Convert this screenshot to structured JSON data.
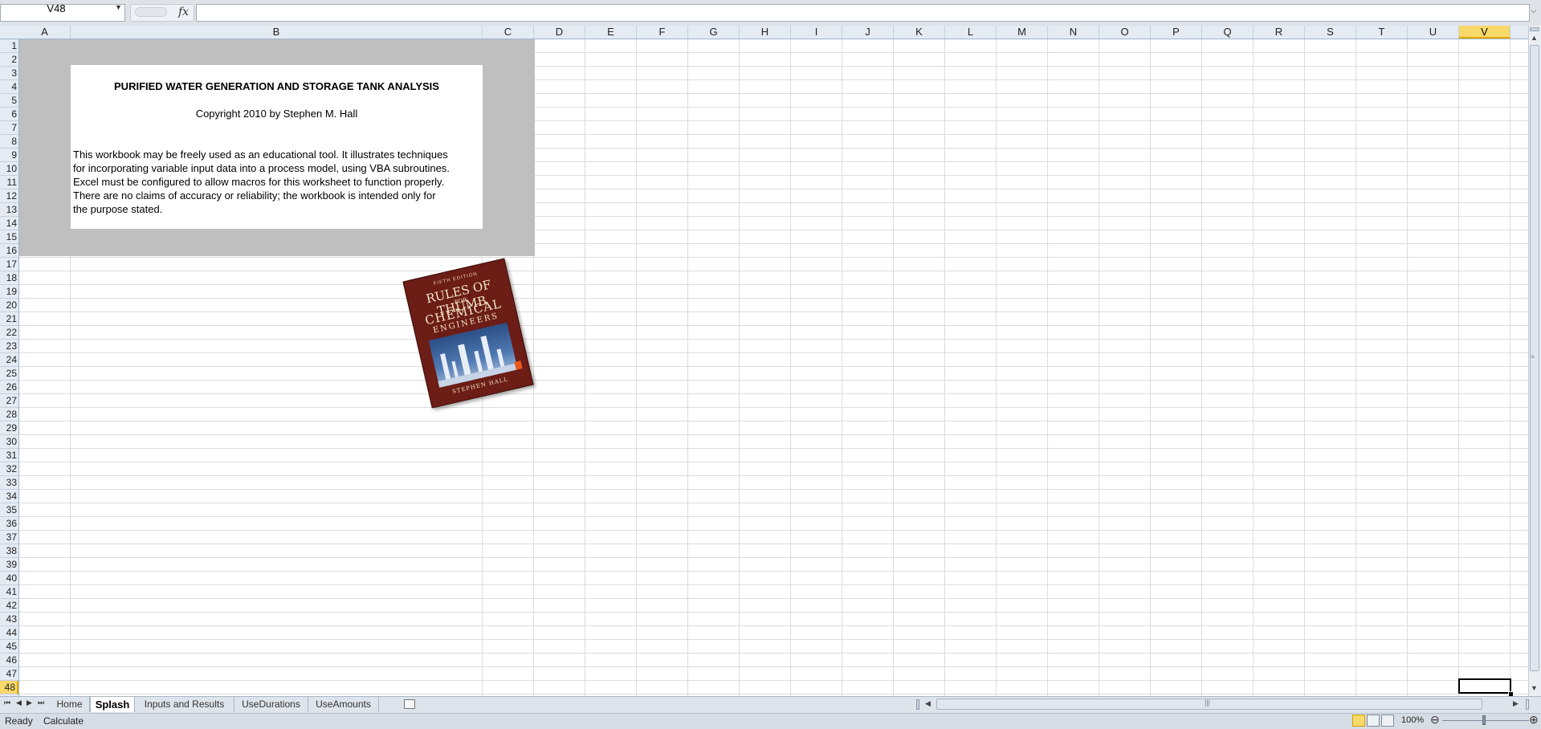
{
  "formula_bar": {
    "name_box": "V48",
    "fx_label": "fx",
    "formula": ""
  },
  "columns": [
    {
      "label": "A",
      "w": 64
    },
    {
      "label": "B",
      "w": 513
    },
    {
      "label": "C",
      "w": 64
    },
    {
      "label": "D",
      "w": 64
    },
    {
      "label": "E",
      "w": 64
    },
    {
      "label": "F",
      "w": 64
    },
    {
      "label": "G",
      "w": 64
    },
    {
      "label": "H",
      "w": 64
    },
    {
      "label": "I",
      "w": 64
    },
    {
      "label": "J",
      "w": 64
    },
    {
      "label": "K",
      "w": 64
    },
    {
      "label": "L",
      "w": 64
    },
    {
      "label": "M",
      "w": 64
    },
    {
      "label": "N",
      "w": 64
    },
    {
      "label": "O",
      "w": 64
    },
    {
      "label": "P",
      "w": 64
    },
    {
      "label": "Q",
      "w": 64
    },
    {
      "label": "R",
      "w": 64
    },
    {
      "label": "S",
      "w": 64
    },
    {
      "label": "T",
      "w": 64
    },
    {
      "label": "U",
      "w": 64
    },
    {
      "label": "V",
      "w": 64
    }
  ],
  "selected_column": "V",
  "selected_row": 48,
  "row_count": 48,
  "splash": {
    "title": "PURIFIED WATER GENERATION AND STORAGE TANK ANALYSIS",
    "copyright": "Copyright 2010 by Stephen M. Hall",
    "lines": [
      "This workbook may be freely used as an educational tool. It illustrates techniques",
      "for incorporating variable input data into a process model, using VBA subroutines.",
      "Excel must be configured to allow macros for this worksheet to function properly.",
      "There are no claims of accuracy or reliability; the workbook is intended only for",
      "the purpose stated."
    ]
  },
  "book": {
    "edition": "FIFTH EDITION",
    "title_line1": "RULES OF THUMB",
    "title_line2": "FOR",
    "title_line3": "CHEMICAL",
    "title_line4": "ENGINEERS",
    "author": "STEPHEN HALL"
  },
  "sheet_tabs": [
    {
      "label": "Home",
      "active": false
    },
    {
      "label": "Splash",
      "active": true
    },
    {
      "label": "Inputs and Results",
      "active": false
    },
    {
      "label": "UseDurations",
      "active": false
    },
    {
      "label": "UseAmounts",
      "active": false
    }
  ],
  "status": {
    "ready": "Ready",
    "calculate": "Calculate",
    "zoom": "100%"
  },
  "colors": {
    "header_bg": "#e4ebf3",
    "selected_header": "#f9d96a",
    "banner_gray": "#bfbfbf",
    "book_cover": "#6b1d16"
  },
  "icons": {
    "fx": "function-icon",
    "dropdown": "chevron-down-icon",
    "scroll_up": "arrow-up-icon",
    "scroll_down": "arrow-down-icon",
    "new_sheet": "insert-worksheet-icon"
  }
}
